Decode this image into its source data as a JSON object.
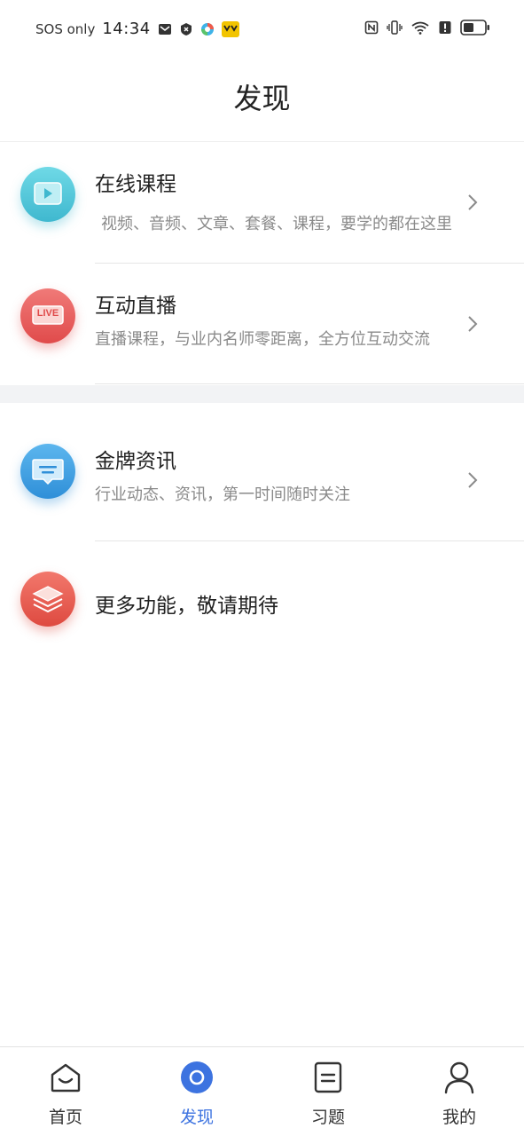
{
  "status_bar": {
    "sos": "SOS only",
    "time": "14:34"
  },
  "header": {
    "title": "发现"
  },
  "items": [
    {
      "title": "在线课程",
      "desc": "视频、音频、文章、套餐、课程，要学的都在这里",
      "icon": "video-play-icon",
      "color": "#4fc6d6"
    },
    {
      "title": "互动直播",
      "desc": "直播课程，与业内名师零距离，全方位互动交流",
      "icon": "live-icon",
      "badge": "LIVE",
      "color": "#ec5c5c"
    },
    {
      "title": "金牌资讯",
      "desc": "行业动态、资讯，第一时间随时关注",
      "icon": "message-icon",
      "color": "#3d9ee0"
    },
    {
      "title": "更多功能，敬请期待",
      "icon": "layers-icon",
      "color": "#e85a4f"
    }
  ],
  "tabs": [
    {
      "label": "首页",
      "icon": "home-icon",
      "active": false
    },
    {
      "label": "发现",
      "icon": "discover-icon",
      "active": true
    },
    {
      "label": "习题",
      "icon": "exercise-icon",
      "active": false
    },
    {
      "label": "我的",
      "icon": "profile-icon",
      "active": false
    }
  ],
  "colors": {
    "accent": "#3d73e0",
    "divider": "#e6e6e6",
    "section_bg": "#f2f3f5"
  }
}
